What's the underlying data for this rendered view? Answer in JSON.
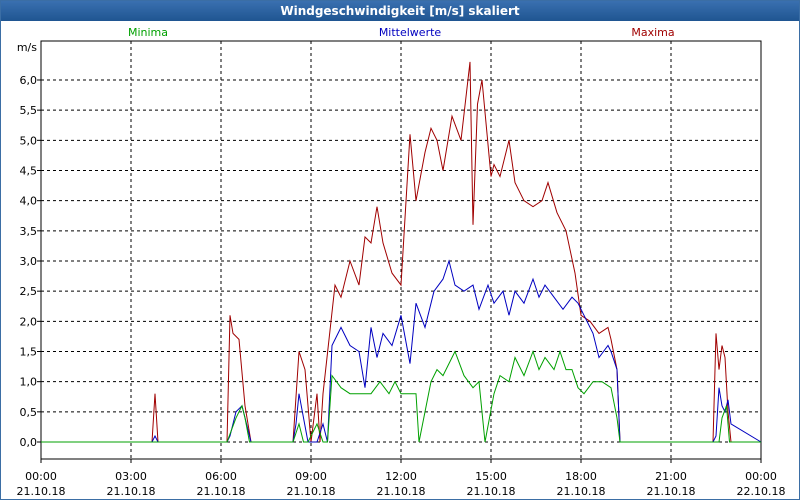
{
  "window": {
    "title": "Windgeschwindigkeit [m/s] skaliert"
  },
  "chart_data": {
    "type": "line",
    "title": "Windgeschwindigkeit [m/s] skaliert",
    "ylabel": "m/s",
    "xlabel": "",
    "ylim": [
      0,
      6.5
    ],
    "xlim_hours": [
      0,
      24
    ],
    "grid": true,
    "legend_placement": "top",
    "yticks": [
      {
        "v": 0.0,
        "label": "0,0"
      },
      {
        "v": 0.5,
        "label": "0,5"
      },
      {
        "v": 1.0,
        "label": "1,0"
      },
      {
        "v": 1.5,
        "label": "1,5"
      },
      {
        "v": 2.0,
        "label": "2,0"
      },
      {
        "v": 2.5,
        "label": "2,5"
      },
      {
        "v": 3.0,
        "label": "3,0"
      },
      {
        "v": 3.5,
        "label": "3,5"
      },
      {
        "v": 4.0,
        "label": "4,0"
      },
      {
        "v": 4.5,
        "label": "4,5"
      },
      {
        "v": 5.0,
        "label": "5,0"
      },
      {
        "v": 5.5,
        "label": "5,5"
      },
      {
        "v": 6.0,
        "label": "6,0"
      }
    ],
    "xticks": [
      {
        "h": 0,
        "time": "00:00",
        "date": "21.10.18"
      },
      {
        "h": 3,
        "time": "03:00",
        "date": "21.10.18"
      },
      {
        "h": 6,
        "time": "06:00",
        "date": "21.10.18"
      },
      {
        "h": 9,
        "time": "09:00",
        "date": "21.10.18"
      },
      {
        "h": 12,
        "time": "12:00",
        "date": "21.10.18"
      },
      {
        "h": 15,
        "time": "15:00",
        "date": "21.10.18"
      },
      {
        "h": 18,
        "time": "18:00",
        "date": "21.10.18"
      },
      {
        "h": 21,
        "time": "21:00",
        "date": "21.10.18"
      },
      {
        "h": 24,
        "time": "00:00",
        "date": "22.10.18"
      }
    ],
    "series": [
      {
        "name": "Minima",
        "color": "#00a000",
        "x": [
          0,
          6.2,
          6.5,
          6.7,
          6.8,
          6.95,
          7.1,
          8.4,
          8.6,
          8.75,
          8.9,
          9.2,
          9.4,
          9.55,
          9.7,
          10.0,
          10.3,
          11.0,
          11.3,
          11.6,
          11.8,
          12.0,
          12.5,
          12.6,
          13.0,
          13.2,
          13.4,
          13.8,
          14.1,
          14.4,
          14.6,
          14.8,
          15.1,
          15.3,
          15.6,
          15.8,
          16.1,
          16.4,
          16.6,
          16.8,
          17.1,
          17.3,
          17.5,
          17.7,
          17.9,
          18.1,
          18.4,
          18.7,
          19.0,
          19.2,
          19.3,
          22.5,
          22.6,
          22.7,
          22.85,
          22.95,
          24
        ],
        "y": [
          0,
          0,
          0.4,
          0.6,
          0.4,
          0,
          0,
          0,
          0.3,
          0,
          0,
          0.3,
          0,
          0,
          1.1,
          0.9,
          0.8,
          0.8,
          1.0,
          0.8,
          1.0,
          0.8,
          0.8,
          0,
          1.0,
          1.2,
          1.1,
          1.5,
          1.1,
          0.9,
          1.0,
          0,
          0.8,
          1.1,
          1.0,
          1.4,
          1.1,
          1.5,
          1.2,
          1.4,
          1.2,
          1.5,
          1.2,
          1.2,
          0.9,
          0.8,
          1.0,
          1.0,
          0.9,
          0.4,
          0,
          0,
          0,
          0.4,
          0.6,
          0,
          0
        ]
      },
      {
        "name": "Mittelwerte",
        "color": "#0000c0",
        "x": [
          0,
          3.7,
          3.8,
          3.9,
          6.2,
          6.3,
          6.5,
          6.7,
          6.85,
          7.0,
          8.4,
          8.5,
          8.6,
          8.75,
          8.9,
          9.2,
          9.4,
          9.55,
          9.7,
          10.0,
          10.3,
          10.6,
          10.8,
          11.0,
          11.2,
          11.4,
          11.7,
          12.0,
          12.3,
          12.5,
          12.8,
          13.1,
          13.4,
          13.6,
          13.8,
          14.1,
          14.4,
          14.6,
          14.9,
          15.1,
          15.4,
          15.6,
          15.8,
          16.1,
          16.4,
          16.6,
          16.8,
          17.1,
          17.4,
          17.7,
          17.9,
          18.1,
          18.4,
          18.6,
          18.9,
          19.0,
          19.2,
          19.3,
          22.4,
          22.5,
          22.6,
          22.7,
          22.8,
          22.9,
          23.0,
          24
        ],
        "y": [
          0,
          0,
          0.1,
          0,
          0,
          0.1,
          0.5,
          0.6,
          0.3,
          0,
          0,
          0.3,
          0.8,
          0.4,
          0,
          0,
          0.3,
          0,
          1.6,
          1.9,
          1.6,
          1.5,
          0.9,
          1.9,
          1.4,
          1.8,
          1.6,
          2.1,
          1.3,
          2.3,
          1.9,
          2.5,
          2.7,
          3.0,
          2.6,
          2.5,
          2.6,
          2.2,
          2.6,
          2.3,
          2.5,
          2.1,
          2.5,
          2.3,
          2.7,
          2.4,
          2.6,
          2.4,
          2.2,
          2.4,
          2.3,
          2.1,
          1.8,
          1.4,
          1.6,
          1.5,
          1.2,
          0,
          0,
          0.1,
          0.9,
          0.6,
          0.5,
          0.7,
          0.3,
          0
        ]
      },
      {
        "name": "Maxima",
        "color": "#a00000",
        "x": [
          0,
          3.7,
          3.8,
          3.9,
          6.2,
          6.3,
          6.4,
          6.6,
          6.8,
          7.0,
          8.4,
          8.6,
          8.8,
          9.0,
          9.2,
          9.3,
          9.4,
          9.6,
          9.8,
          10.0,
          10.3,
          10.6,
          10.8,
          11.0,
          11.2,
          11.4,
          11.7,
          12.0,
          12.3,
          12.5,
          12.8,
          13.0,
          13.2,
          13.4,
          13.7,
          14.0,
          14.3,
          14.4,
          14.55,
          14.7,
          15.0,
          15.1,
          15.3,
          15.6,
          15.8,
          16.1,
          16.4,
          16.7,
          16.9,
          17.2,
          17.5,
          17.8,
          18.0,
          18.3,
          18.6,
          18.9,
          19.0,
          19.2,
          19.3,
          22.4,
          22.5,
          22.6,
          22.7,
          22.8,
          22.9,
          23.0,
          24
        ],
        "y": [
          0,
          0,
          0.8,
          0,
          0,
          2.1,
          1.8,
          1.7,
          0.6,
          0,
          0,
          1.5,
          1.2,
          0,
          0.8,
          0,
          0.8,
          1.7,
          2.6,
          2.4,
          3.0,
          2.6,
          3.4,
          3.3,
          3.9,
          3.3,
          2.8,
          2.6,
          5.1,
          4.0,
          4.8,
          5.2,
          5.0,
          4.5,
          5.4,
          5.0,
          6.3,
          3.6,
          5.6,
          6.0,
          4.4,
          4.6,
          4.4,
          5.0,
          4.3,
          4.0,
          3.9,
          4.0,
          4.3,
          3.8,
          3.5,
          2.8,
          2.1,
          2.0,
          1.8,
          1.9,
          1.7,
          1.2,
          0,
          0,
          1.8,
          1.2,
          1.6,
          1.4,
          0.5,
          0,
          0
        ]
      }
    ]
  }
}
